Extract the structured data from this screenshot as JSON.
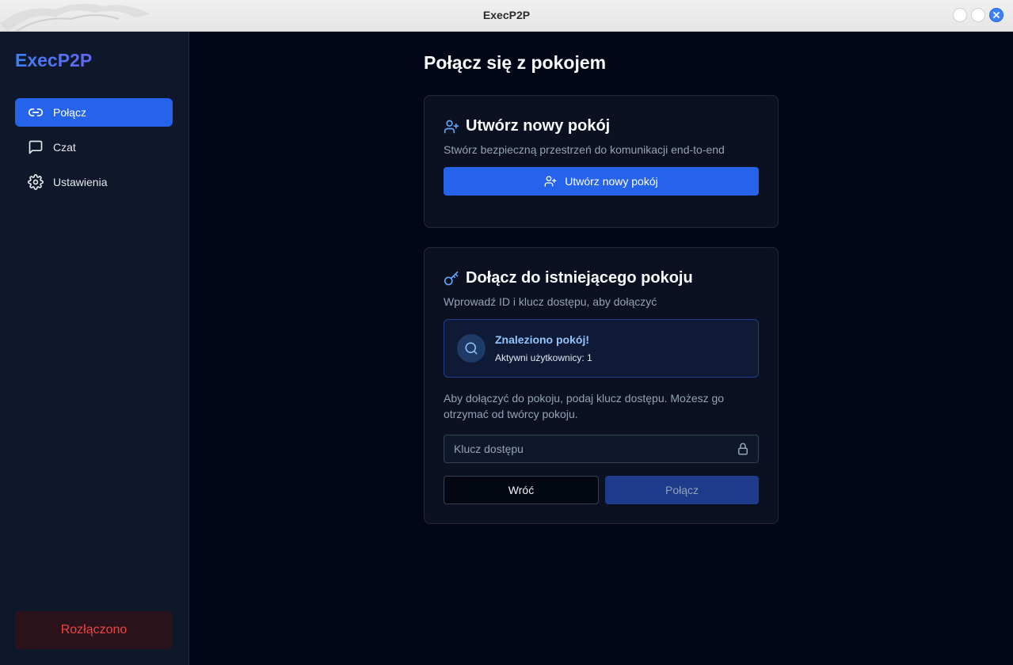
{
  "window": {
    "title": "ExecP2P"
  },
  "sidebar": {
    "brand": "ExecP2P",
    "items": [
      {
        "label": "Połącz",
        "icon": "link-icon",
        "active": true
      },
      {
        "label": "Czat",
        "icon": "chat-icon",
        "active": false
      },
      {
        "label": "Ustawienia",
        "icon": "gear-icon",
        "active": false
      }
    ],
    "status": "Rozłączono"
  },
  "main": {
    "title": "Połącz się z pokojem",
    "create_card": {
      "title": "Utwórz nowy pokój",
      "description": "Stwórz bezpieczną przestrzeń do komunikacji end-to-end",
      "button_label": "Utwórz nowy pokój"
    },
    "join_card": {
      "title": "Dołącz do istniejącego pokoju",
      "description": "Wprowadź ID i klucz dostępu, aby dołączyć",
      "found": {
        "title": "Znaleziono pokój!",
        "subtitle": "Aktywni użytkownicy: 1"
      },
      "hint": "Aby dołączyć do pokoju, podaj klucz dostępu. Możesz go otrzymać od twórcy pokoju.",
      "key_placeholder": "Klucz dostępu",
      "key_value": "",
      "back_label": "Wróć",
      "connect_label": "Połącz"
    }
  },
  "colors": {
    "accent": "#2563eb",
    "background": "#020617",
    "sidebar": "#0f172a",
    "status_error": "#ef4444"
  }
}
